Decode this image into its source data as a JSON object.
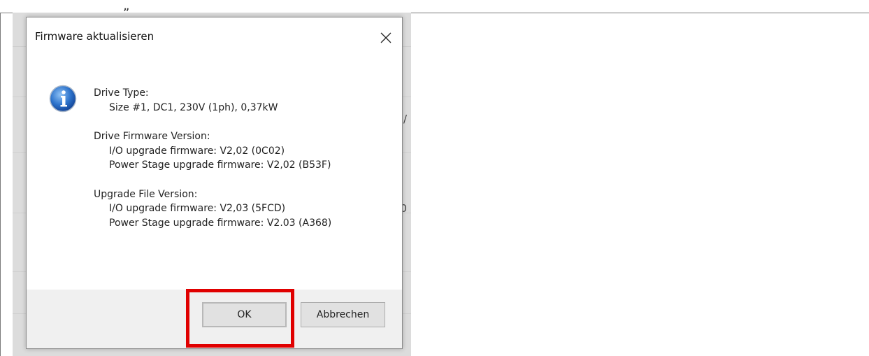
{
  "document": {
    "quote_mark": "„"
  },
  "background_window": {
    "visible_chars": [
      "/",
      "0"
    ]
  },
  "dialog": {
    "title": "Firmware aktualisieren",
    "icon": "info-icon",
    "drive_type_label": "Drive Type:",
    "drive_type_value": "Size #1, DC1, 230V (1ph), 0,37kW",
    "drive_fw_label": "Drive Firmware Version:",
    "drive_fw_io": "I/O upgrade firmware: V2,02 (0C02)",
    "drive_fw_power": "Power Stage upgrade firmware: V2,02 (B53F)",
    "upgrade_label": "Upgrade File Version:",
    "upgrade_io": "I/O upgrade firmware: V2,03 (5FCD)",
    "upgrade_power": "Power Stage upgrade firmware: V2.03 (A368)",
    "ok_label": "OK",
    "cancel_label": "Abbrechen"
  },
  "colors": {
    "highlight": "#e00000",
    "icon_blue": "#1f5fb8"
  }
}
